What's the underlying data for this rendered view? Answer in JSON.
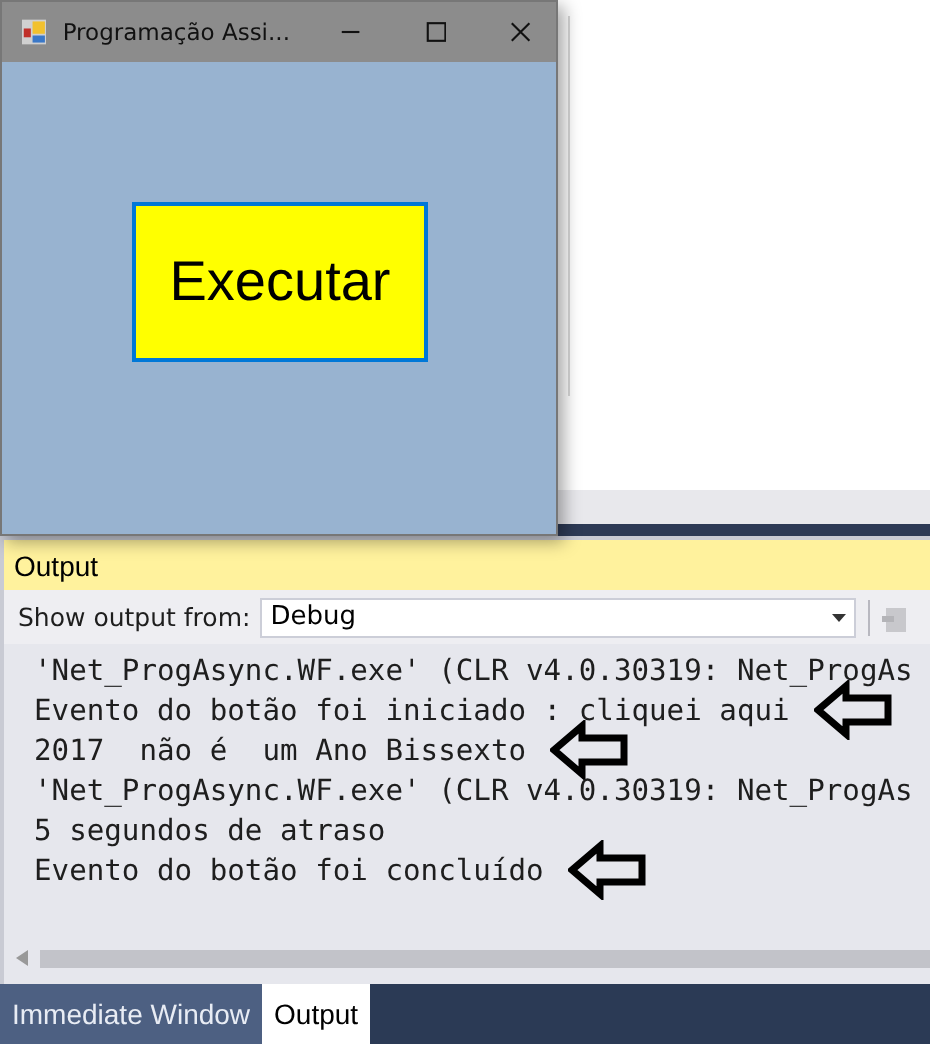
{
  "form_window": {
    "title": "Programação Assi...",
    "button": "Executar"
  },
  "output_panel": {
    "title": "Output",
    "show_output_from_label": "Show output from:",
    "source": "Debug",
    "lines": [
      {
        "text": "'Net_ProgAsync.WF.exe' (CLR v4.0.30319: Net_ProgAs",
        "marked": false
      },
      {
        "text": "Evento do botão foi iniciado : cliquei aqui",
        "marked": true
      },
      {
        "text": "2017  não é  um Ano Bissexto",
        "marked": true
      },
      {
        "text": "'Net_ProgAsync.WF.exe' (CLR v4.0.30319: Net_ProgAs",
        "marked": false
      },
      {
        "text": "5 segundos de atraso",
        "marked": false
      },
      {
        "text": "Evento do botão foi concluído",
        "marked": true
      }
    ]
  },
  "tabs": [
    {
      "label": "Immediate Window",
      "selected": false
    },
    {
      "label": "Output",
      "selected": true
    }
  ]
}
